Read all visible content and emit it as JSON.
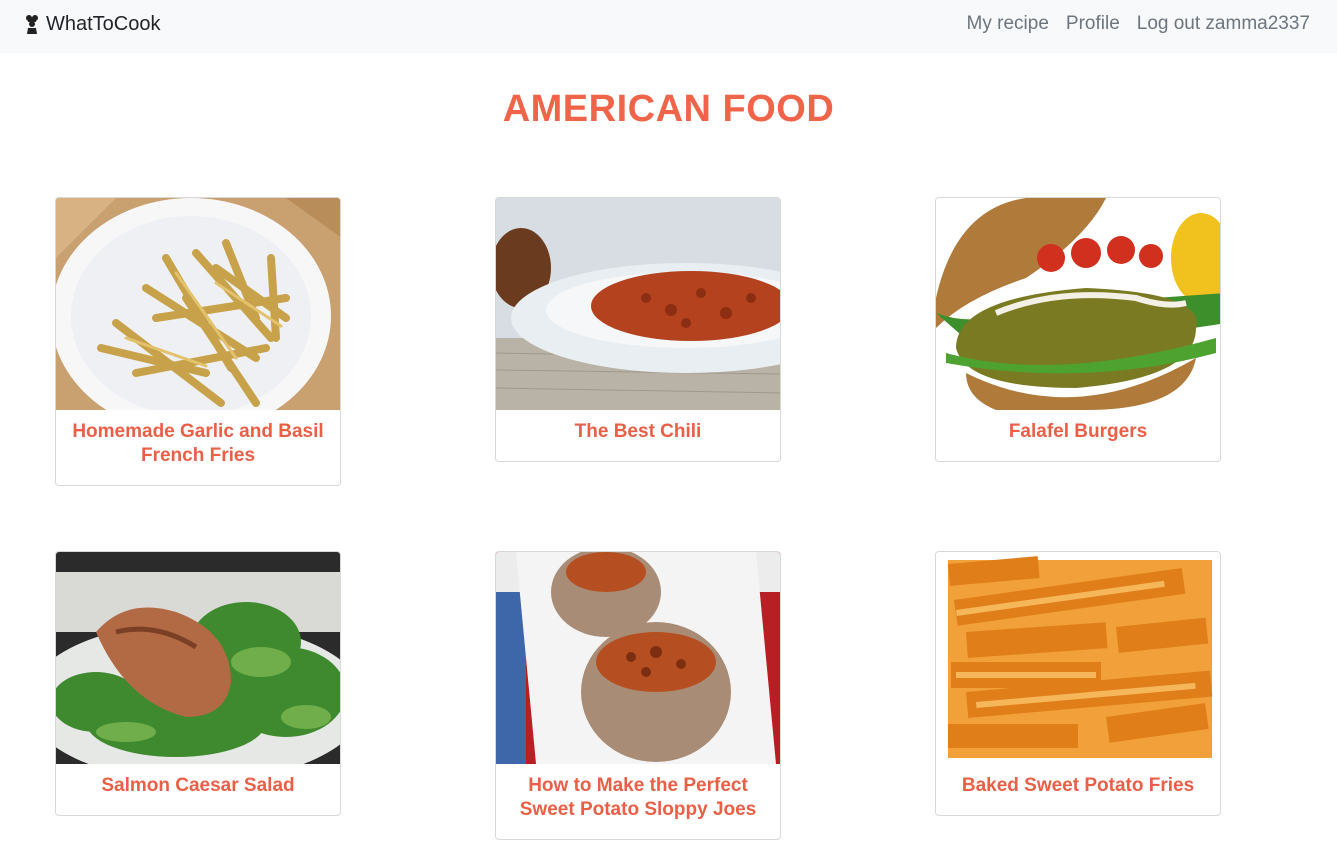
{
  "navbar": {
    "brand": "WhatToCook",
    "brand_icon": "chef-icon",
    "links": [
      "My recipe",
      "Profile",
      "Log out zamma2337"
    ]
  },
  "page": {
    "title": "AMERICAN FOOD"
  },
  "recipes": [
    {
      "title": "Homemade Garlic and Basil French Fries",
      "image": "french-fries-photo"
    },
    {
      "title": "The Best Chili",
      "image": "chili-photo"
    },
    {
      "title": "Falafel Burgers",
      "image": "falafel-burger-photo"
    },
    {
      "title": "Salmon Caesar Salad",
      "image": "salmon-caesar-salad-photo"
    },
    {
      "title": "How to Make the Perfect Sweet Potato Sloppy Joes",
      "image": "sweet-potato-sloppy-joes-photo"
    },
    {
      "title": "Baked Sweet Potato Fries",
      "image": "sweet-potato-fries-photo"
    }
  ],
  "colors": {
    "accent": "#f0654a",
    "navbar_bg": "#f8f9fa",
    "nav_link": "#6c757d"
  }
}
